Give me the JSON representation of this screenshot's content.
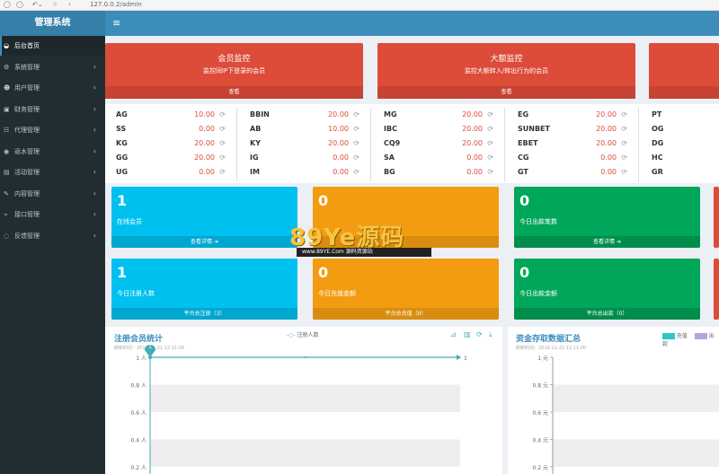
{
  "browser": {
    "url": "127.0.0.2/admin"
  },
  "app": {
    "title": "管理系统"
  },
  "nav": [
    {
      "label": "后台首页",
      "icon": "dashboard-icon"
    },
    {
      "label": "系统管理",
      "icon": "gear-icon"
    },
    {
      "label": "用户管理",
      "icon": "users-icon"
    },
    {
      "label": "财务管理",
      "icon": "money-icon"
    },
    {
      "label": "代理管理",
      "icon": "sitemap-icon"
    },
    {
      "label": "返水管理",
      "icon": "eye-icon"
    },
    {
      "label": "活动管理",
      "icon": "map-icon"
    },
    {
      "label": "内容管理",
      "icon": "edit-icon"
    },
    {
      "label": "接口管理",
      "icon": "plug-icon"
    },
    {
      "label": "反馈管理",
      "icon": "comment-icon"
    }
  ],
  "alerts": [
    {
      "title": "会员监控",
      "desc": "监控同IP下登录的会员",
      "link": "查看"
    },
    {
      "title": "大额监控",
      "desc": "监控大额转入/转出行为的会员",
      "link": "查看"
    }
  ],
  "balances": [
    [
      {
        "name": "AG",
        "amount": "10.00"
      },
      {
        "name": "SS",
        "amount": "0.00"
      },
      {
        "name": "KG",
        "amount": "20.00"
      },
      {
        "name": "GG",
        "amount": "20.00"
      },
      {
        "name": "UG",
        "amount": "0.00"
      }
    ],
    [
      {
        "name": "BBIN",
        "amount": "20.00"
      },
      {
        "name": "AB",
        "amount": "10.00"
      },
      {
        "name": "KY",
        "amount": "20.00"
      },
      {
        "name": "IG",
        "amount": "0.00"
      },
      {
        "name": "IM",
        "amount": "0.00"
      }
    ],
    [
      {
        "name": "MG",
        "amount": "20.00"
      },
      {
        "name": "IBC",
        "amount": "20.00"
      },
      {
        "name": "CQ9",
        "amount": "20.00"
      },
      {
        "name": "SA",
        "amount": "0.00"
      },
      {
        "name": "BG",
        "amount": "0.00"
      }
    ],
    [
      {
        "name": "EG",
        "amount": "20.00"
      },
      {
        "name": "SUNBET",
        "amount": "20.00"
      },
      {
        "name": "EBET",
        "amount": "20.00"
      },
      {
        "name": "CG",
        "amount": "0.00"
      },
      {
        "name": "GT",
        "amount": "0.00"
      }
    ],
    [
      {
        "name": "PT"
      },
      {
        "name": "OG"
      },
      {
        "name": "DG"
      },
      {
        "name": "HC"
      },
      {
        "name": "GR"
      }
    ]
  ],
  "stats": [
    {
      "value": "1",
      "label": "在线会员",
      "footer": "查看详情 ➔"
    },
    {
      "value": "0",
      "label": "",
      "footer": ""
    },
    {
      "value": "0",
      "label": "今日出款笔数",
      "footer": "查看详情 ➔"
    },
    {
      "value": "1",
      "label": "今日注册人数",
      "footer": "平台总注册（3）"
    },
    {
      "value": "0",
      "label": "今日充值金额",
      "footer": "平台总充值（0）"
    },
    {
      "value": "0",
      "label": "今日出款金额",
      "footer": "平台总出款（0）"
    }
  ],
  "watermark": {
    "big": "89Ye源码",
    "small": "www.89YE.Com    源码资源站"
  },
  "charts": {
    "left": {
      "title": "注册会员统计",
      "time": "刷新时间：2019-11-21 12:11:00",
      "legend": "注册人数",
      "peak_label": "1",
      "end_label": "1"
    },
    "right": {
      "title": "资金存取数据汇总",
      "time": "刷新时间：2019-11-21 12:11:00",
      "legend": [
        "充值",
        "出款"
      ]
    }
  },
  "chart_data": [
    {
      "type": "line",
      "title": "注册会员统计",
      "series": [
        {
          "name": "注册人数",
          "values": [
            1,
            1
          ]
        }
      ],
      "yticks": [
        "1 人",
        "0.8 人",
        "0.6 人",
        "0.4 人",
        "0.2 人"
      ],
      "ylim": [
        0,
        1
      ]
    },
    {
      "type": "bar",
      "title": "资金存取数据汇总",
      "series": [
        {
          "name": "充值",
          "values": []
        },
        {
          "name": "出款",
          "values": []
        }
      ],
      "yticks": [
        "1 元",
        "0.8 元",
        "0.6 元",
        "0.4 元",
        "0.2 元"
      ],
      "ylim": [
        0,
        1
      ]
    }
  ],
  "colors": {
    "header": "#3c8dbc",
    "sidebar": "#222d32",
    "red": "#dd4b39",
    "aqua": "#00c0ef",
    "yellow": "#f39c12",
    "green": "#00a65a"
  }
}
